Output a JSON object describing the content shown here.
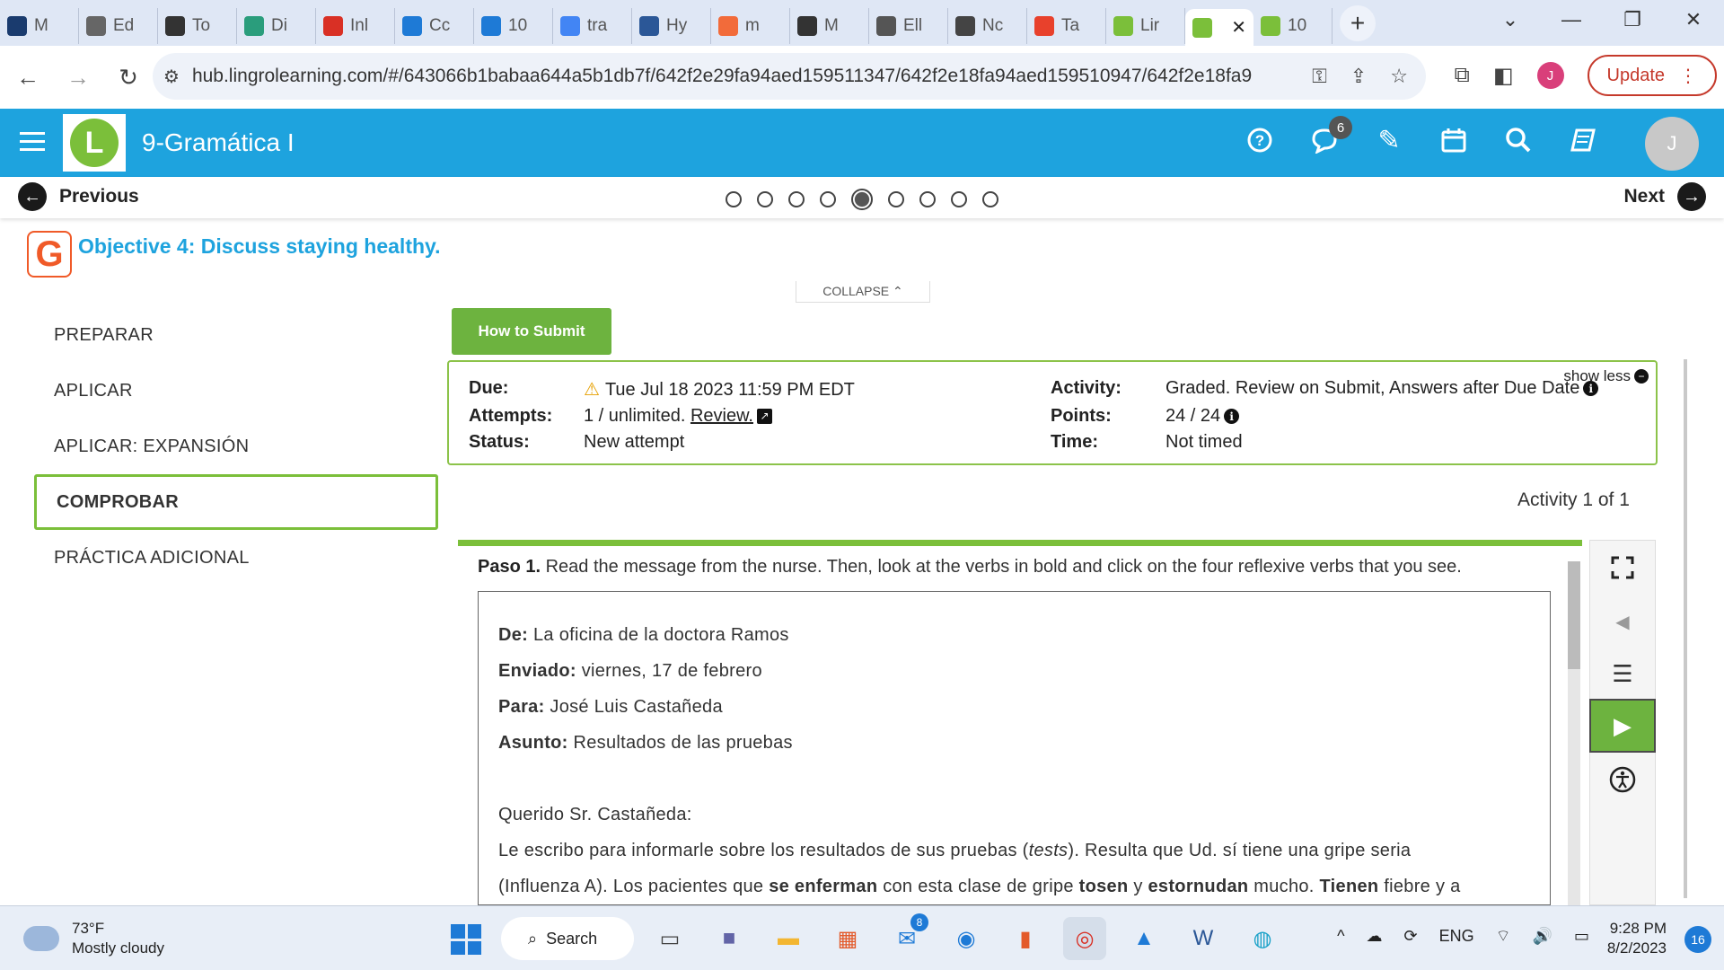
{
  "browser": {
    "tabs": [
      {
        "label": "M",
        "icon": "odu-icon",
        "color": "#1a3b6e"
      },
      {
        "label": "Ed",
        "icon": "globe-icon",
        "color": "#666666"
      },
      {
        "label": "To",
        "icon": "crown-icon",
        "color": "#333333"
      },
      {
        "label": "Di",
        "icon": "openai-icon",
        "color": "#2a9d7c"
      },
      {
        "label": "Inl",
        "icon": "gmail-icon",
        "color": "#d93025"
      },
      {
        "label": "Cc",
        "icon": "c-icon",
        "color": "#1e7ad6"
      },
      {
        "label": "10",
        "icon": "hand-icon",
        "color": "#1e7ad6"
      },
      {
        "label": "tra",
        "icon": "google-icon",
        "color": "#4285f4"
      },
      {
        "label": "Hy",
        "icon": "h-icon",
        "color": "#2b5797"
      },
      {
        "label": "m",
        "icon": "ring-icon",
        "color": "#f26b3a"
      },
      {
        "label": "M",
        "icon": "odu-icon",
        "color": "#333333"
      },
      {
        "label": "Ell",
        "icon": "globe-icon",
        "color": "#555555"
      },
      {
        "label": "Nc",
        "icon": "chrome-icon",
        "color": "#444444"
      },
      {
        "label": "Ta",
        "icon": "ta-icon",
        "color": "#e8412c"
      },
      {
        "label": "Lir",
        "icon": "lingro-icon",
        "color": "#7bbf3a"
      },
      {
        "label": "",
        "icon": "lingro-icon",
        "color": "#7bbf3a",
        "active": true
      },
      {
        "label": "10",
        "icon": "lingro-icon",
        "color": "#7bbf3a"
      }
    ],
    "url": "hub.lingrolearning.com/#/643066b1babaa644a5b1db7f/642f2e29fa94aed159511347/642f2e18fa94aed159510947/642f2e18fa94a...",
    "update_label": "Update",
    "profile_initial": "J"
  },
  "app": {
    "title": "9-Gramática I",
    "chat_badge": "6",
    "avatar_initial": "J"
  },
  "pager": {
    "previous": "Previous",
    "next": "Next",
    "total_dots": 9,
    "current_dot": 5
  },
  "objective": {
    "logo_letter": "G",
    "title": "Objective 4: Discuss staying healthy.",
    "collapse_label": "COLLAPSE"
  },
  "sidebar": {
    "items": [
      {
        "label": "PREPARAR"
      },
      {
        "label": "APLICAR"
      },
      {
        "label": "APLICAR: EXPANSIÓN"
      },
      {
        "label": "COMPROBAR",
        "active": true
      },
      {
        "label": "PRÁCTICA ADICIONAL"
      }
    ]
  },
  "activity": {
    "how_to_submit": "How to Submit",
    "show_less": "show less",
    "due_label": "Due:",
    "due_value": "Tue Jul 18 2023 11:59 PM EDT",
    "attempts_label": "Attempts:",
    "attempts_value": "1 / unlimited.",
    "review_link": "Review.",
    "status_label": "Status:",
    "status_value": "New attempt",
    "activity_label": "Activity:",
    "activity_value": "Graded. Review on Submit, Answers after Due Date",
    "points_label": "Points:",
    "points_value": "24 / 24",
    "time_label": "Time:",
    "time_value": "Not timed",
    "count": "Activity 1 of 1"
  },
  "step": {
    "label": "Paso 1.",
    "text": "Read the message from the nurse. Then, look at the verbs in bold and click on the four reflexive verbs that you see."
  },
  "message": {
    "de_label": "De:",
    "de_value": "La oficina de la doctora Ramos",
    "enviado_label": "Enviado:",
    "enviado_value": "viernes, 17 de febrero",
    "para_label": "Para:",
    "para_value": "José Luis Castañeda",
    "asunto_label": "Asunto:",
    "asunto_value": "Resultados de las pruebas",
    "greeting": "Querido Sr. Castañeda:",
    "p1_a": "Le escribo para informarle sobre los resultados de sus pruebas (",
    "p1_tests": "tests",
    "p1_b": "). Resulta que Ud. sí tiene una gripe seria",
    "p2_a": "(Influenza A). Los pacientes que ",
    "verb1": "se enferman",
    "p2_b": " con esta clase de gripe ",
    "verb2": "tosen",
    "p2_c": " y ",
    "verb3": "estornudan",
    "p2_d": " mucho. ",
    "verb4": "Tienen",
    "p2_e": " fiebre y a"
  },
  "taskbar": {
    "temp": "73°F",
    "weather": "Mostly cloudy",
    "search": "Search",
    "mail_badge": "8",
    "lang": "ENG",
    "time": "9:28 PM",
    "date": "8/2/2023",
    "notifications": "16"
  }
}
